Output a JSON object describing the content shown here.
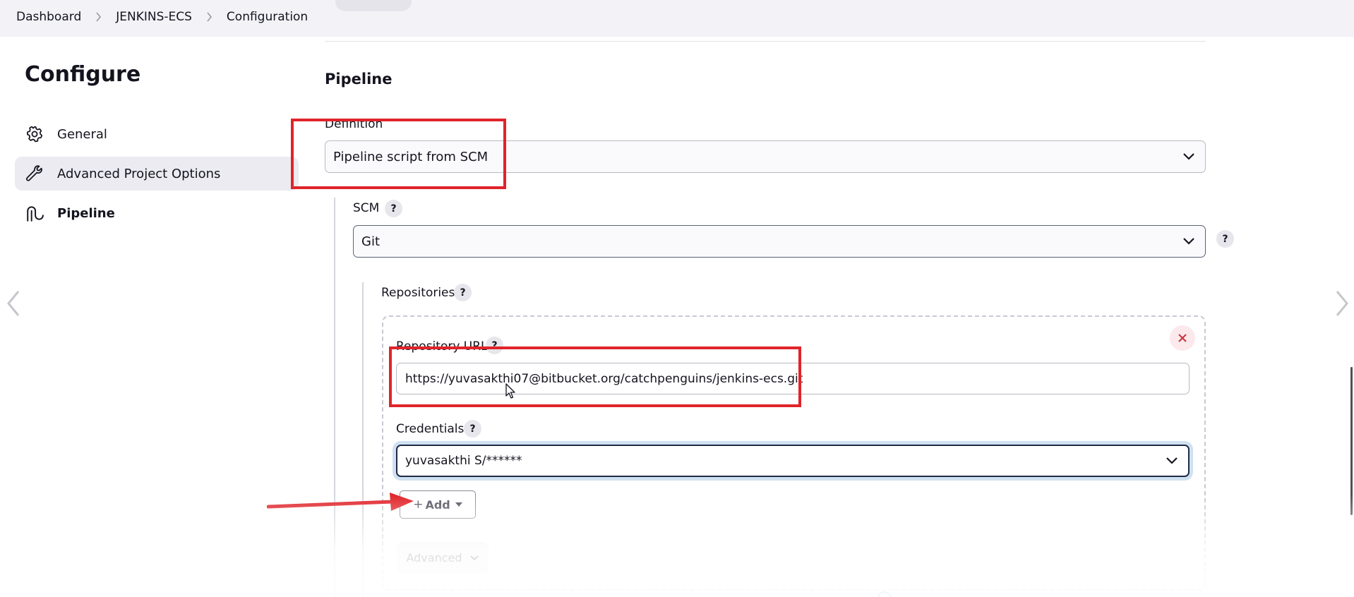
{
  "breadcrumb": {
    "items": [
      "Dashboard",
      "JENKINS-ECS",
      "Configuration"
    ]
  },
  "sidebar": {
    "title": "Configure",
    "items": [
      {
        "label": "General",
        "icon": "gear-icon"
      },
      {
        "label": "Advanced Project Options",
        "icon": "wrench-icon"
      },
      {
        "label": "Pipeline",
        "icon": "pipeline-icon"
      }
    ]
  },
  "pipeline": {
    "section_title": "Pipeline",
    "definition_label": "Definition",
    "definition_value": "Pipeline script from SCM",
    "scm_label": "SCM",
    "scm_value": "Git",
    "help_glyph": "?",
    "repositories": {
      "label": "Repositories",
      "repository_url_label": "Repository URL",
      "repository_url_value": "https://yuvasakthi07@bitbucket.org/catchpenguins/jenkins-ecs.git",
      "credentials_label": "Credentials",
      "credentials_value": "yuvasakthi S/******",
      "add_plus": "+",
      "add_label": "Add",
      "advanced_label": "Advanced"
    }
  },
  "colors": {
    "highlight": "#e0242a",
    "accent": "#2e6fdc",
    "focus_ring": "#cfe1f0"
  }
}
